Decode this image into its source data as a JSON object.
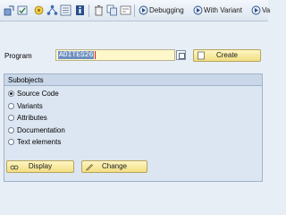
{
  "toolbar": {
    "debugging_label": "Debugging",
    "with_variant_label": "With Variant",
    "overflow_label": "Va"
  },
  "form": {
    "program_label": "Program",
    "program_value": "ADITES26",
    "create_label": "Create"
  },
  "subobjects": {
    "title": "Subobjects",
    "options": [
      {
        "label": "Source Code",
        "selected": true
      },
      {
        "label": "Variants",
        "selected": false
      },
      {
        "label": "Attributes",
        "selected": false
      },
      {
        "label": "Documentation",
        "selected": false
      },
      {
        "label": "Text elements",
        "selected": false
      }
    ],
    "display_label": "Display",
    "change_label": "Change"
  },
  "colors": {
    "background": "#e8eef6",
    "button_yellow": "#f1de84",
    "field_yellow": "#fdf7c9",
    "selection_blue": "#6d8fc0"
  }
}
